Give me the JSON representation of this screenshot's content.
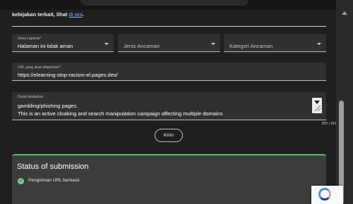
{
  "intro": {
    "text": "kebijakan terkait, lihat ",
    "link": "di sini",
    "suffix": "."
  },
  "form": {
    "report_type": {
      "label": "Jenis Laporan*",
      "value": "Halaman ini tidak aman"
    },
    "threat_type": {
      "label": "Jenis Ancaman"
    },
    "threat_category": {
      "label": "Kategori Ancaman"
    },
    "url": {
      "label": "URL yang akan dilaporkan*",
      "value": "https://elearning-stop-racism-el.pages.dev/"
    },
    "details": {
      "label": "Detail tambahan",
      "line1": "gambling/phishing pages.",
      "line2": "This is an active cloaking and search manipulation campaign affecting multiple domains",
      "counter": "390 / 800"
    },
    "submit_label": "Kirim"
  },
  "status": {
    "title": "Status of submission",
    "message": "Pengiriman URL berhasil.",
    "success_color": "#5fb97b"
  }
}
